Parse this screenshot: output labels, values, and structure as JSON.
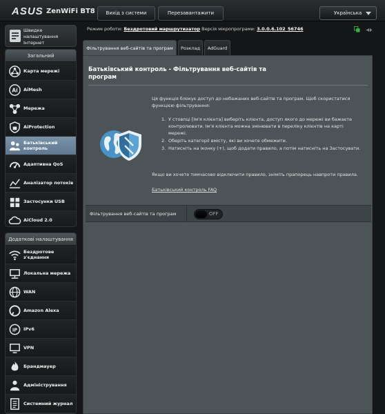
{
  "header": {
    "brand": "ASUS",
    "model": "ZenWiFi BT8",
    "logout_label": "Вихід з системи",
    "reboot_label": "Перезавантажити",
    "language": "Українська"
  },
  "status": {
    "mode_label": "Режим роботи:",
    "mode_value": "Бездротовий маршрутизатор",
    "firmware_label": "Версія мікропрограми:",
    "firmware_value": "3.0.0.6.102_56746"
  },
  "sidebar": {
    "quick_setup_label": "Швидке налаштування Інтернет",
    "general_header": "Загальний",
    "general_items": [
      {
        "label": "Карта мережі",
        "icon": "network-map-icon"
      },
      {
        "label": "AiMesh",
        "icon": "aimesh-icon"
      },
      {
        "label": "Мережа",
        "icon": "network-icon"
      },
      {
        "label": "AiProtection",
        "icon": "aiprotection-icon"
      },
      {
        "label": "Батьківський контроль",
        "icon": "parental-control-icon",
        "active": true
      },
      {
        "label": "Адаптивна QoS",
        "icon": "qos-icon"
      },
      {
        "label": "Аналізатор потоків",
        "icon": "traffic-analyzer-icon"
      },
      {
        "label": "Застосунки USB",
        "icon": "usb-icon"
      },
      {
        "label": "AiCloud 2.0",
        "icon": "cloud-icon"
      }
    ],
    "advanced_header": "Додаткові налаштування",
    "advanced_items": [
      {
        "label": "Бездротове з'єднання",
        "icon": "wireless-icon"
      },
      {
        "label": "Локальна мережа",
        "icon": "lan-icon"
      },
      {
        "label": "WAN",
        "icon": "wan-icon"
      },
      {
        "label": "Amazon Alexa",
        "icon": "alexa-icon"
      },
      {
        "label": "IPv6",
        "icon": "ipv6-icon"
      },
      {
        "label": "VPN",
        "icon": "vpn-icon"
      },
      {
        "label": "Брандмауер",
        "icon": "firewall-icon"
      },
      {
        "label": "Адміністрування",
        "icon": "administration-icon"
      },
      {
        "label": "Системний журнал",
        "icon": "system-log-icon"
      }
    ]
  },
  "tabs": [
    {
      "label": "Фільтрування веб-сайтів та програм",
      "active": true
    },
    {
      "label": "Розклад",
      "active": false
    },
    {
      "label": "AdGuard",
      "active": false
    }
  ],
  "content": {
    "title": "Батьківський контроль - Фільтрування веб-сайтів та програм",
    "intro": "Ця функція блокує доступ до небажаних веб-сайтів та програм. Щоб скористатися функцією фільтрування:",
    "steps": [
      "У стовпці [Ім'я клієнта] виберіть клієнта, доступ якого до мережі ви бажаєте контролювати. Ім'я клієнта можна змінювати в переліку клієнтів на карті мережі.",
      "Оберіть категорії вмісту, які ви хочете обмежити.",
      "Натисніть на іконку (+), щоб додати правило, а потім натисніть на Застосувати."
    ],
    "note": "Якщо ви хочете тимчасово відключити правило, зніміть прапорець навпроти правила.",
    "faq_link": "Батьківський контроль FAQ",
    "setting_label": "Фільтрування веб-сайтів та програм",
    "toggle_state": "OFF"
  },
  "colors": {
    "panel": "#4c5458",
    "active_menu": "#6e879c",
    "accent_blue": "#4a93c9"
  }
}
